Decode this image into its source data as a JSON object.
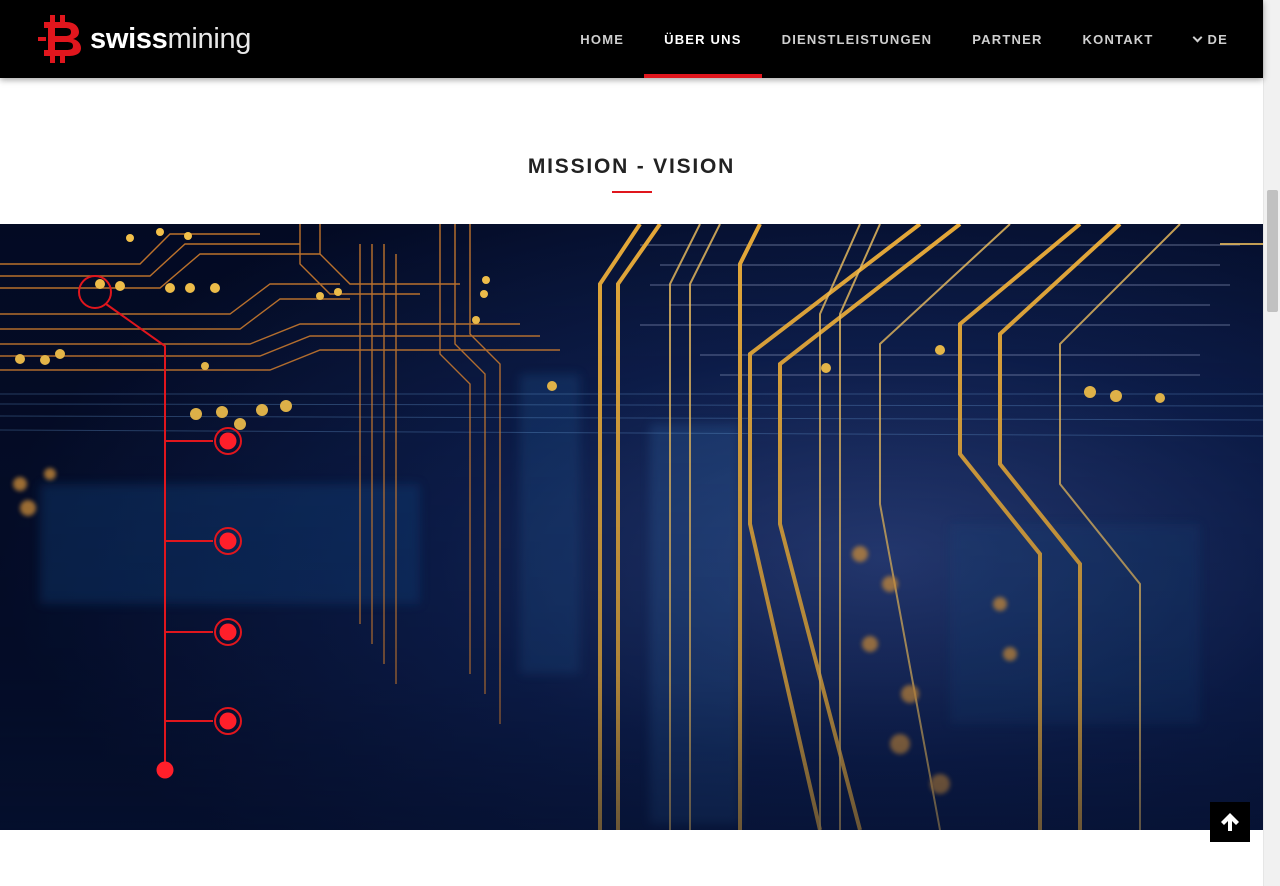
{
  "header": {
    "logo": {
      "text_bold": "swiss",
      "text_light": "mining"
    },
    "nav": [
      {
        "label": "HOME",
        "active": false
      },
      {
        "label": "ÜBER UNS",
        "active": true
      },
      {
        "label": "DIENSTLEISTUNGEN",
        "active": false
      },
      {
        "label": "PARTNER",
        "active": false
      },
      {
        "label": "KONTAKT",
        "active": false
      }
    ],
    "language": "DE"
  },
  "section": {
    "title": "MISSION - VISION"
  },
  "colors": {
    "accent": "#e0161d",
    "header_bg": "#000000",
    "hero_bg": "#061233",
    "circuit_gold": "#f2b13a",
    "circuit_orange": "#e07a2a"
  },
  "icons": {
    "logo_mark": "bitcoin-b-icon",
    "language_chevron": "chevron-down-icon",
    "back_to_top": "arrow-up-icon"
  }
}
